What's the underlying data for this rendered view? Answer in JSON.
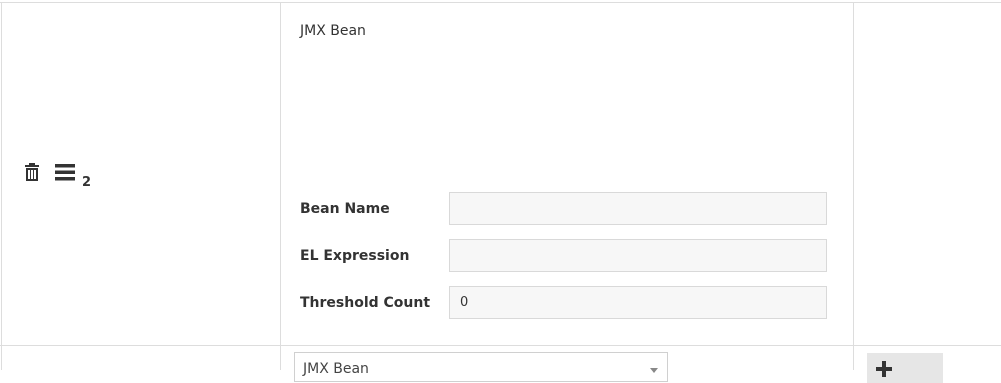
{
  "row": {
    "index": "2",
    "type_title": "JMX Bean",
    "fields": [
      {
        "label": "Bean Name",
        "value": "",
        "placeholder": ""
      },
      {
        "label": "EL Expression",
        "value": "",
        "placeholder": ""
      },
      {
        "label": "Threshold Count",
        "value": "0",
        "placeholder": ""
      }
    ]
  },
  "new_row": {
    "select_value": "JMX Bean"
  },
  "icons": {
    "delete": "trash-icon",
    "reorder": "hamburger-menu-icon",
    "add": "plus-icon",
    "dropdown": "chevron-down-icon"
  }
}
